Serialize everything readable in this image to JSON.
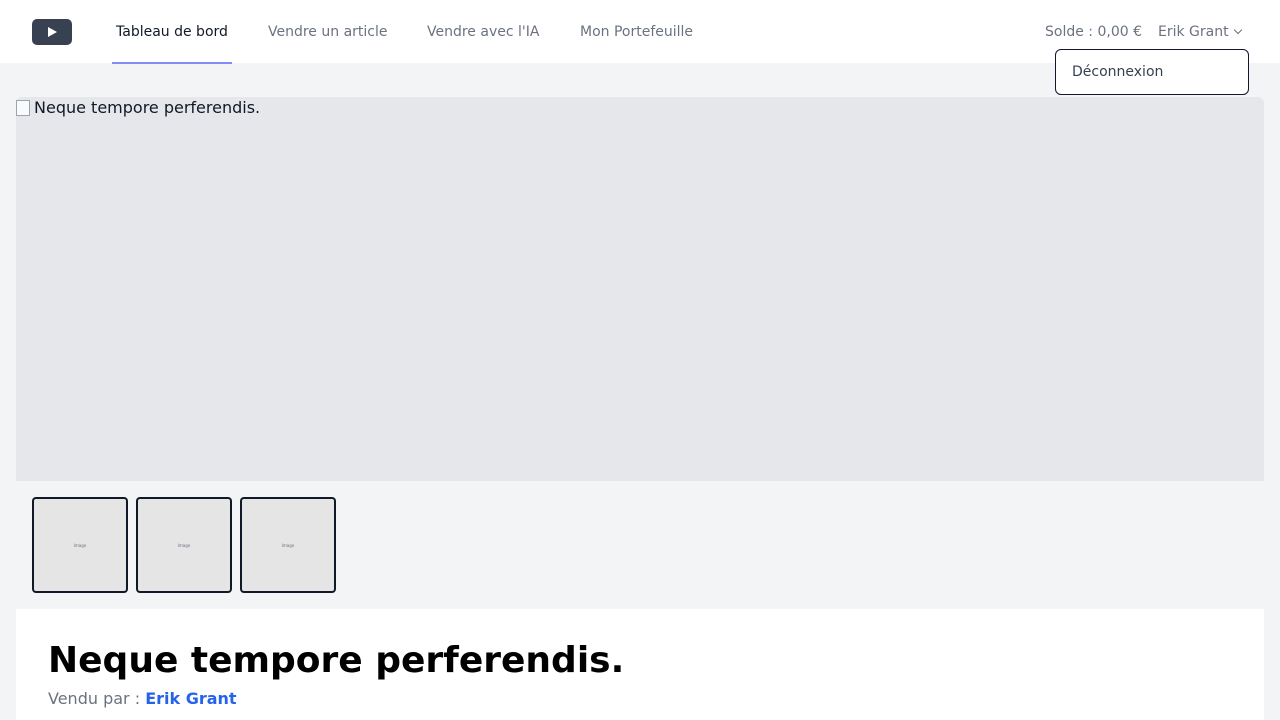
{
  "nav": {
    "logo_icon": "play-icon",
    "links": [
      {
        "label": "Tableau de bord",
        "active": true
      },
      {
        "label": "Vendre un article",
        "active": false
      },
      {
        "label": "Vendre avec l'IA",
        "active": false
      },
      {
        "label": "Mon Portefeuille",
        "active": false
      }
    ],
    "balance": "Solde : 0,00 €",
    "user_name": "Erik Grant",
    "dropdown_item": "Déconnexion"
  },
  "product": {
    "image_alt": "Neque tempore perferendis.",
    "thumbnails": [
      "Image",
      "Image",
      "Image"
    ],
    "title": "Neque tempore perferendis.",
    "sold_by_label": "Vendu par :",
    "seller_name": "Erik Grant"
  },
  "colors": {
    "accent_underline": "#818cf8",
    "link_blue": "#2563eb"
  }
}
